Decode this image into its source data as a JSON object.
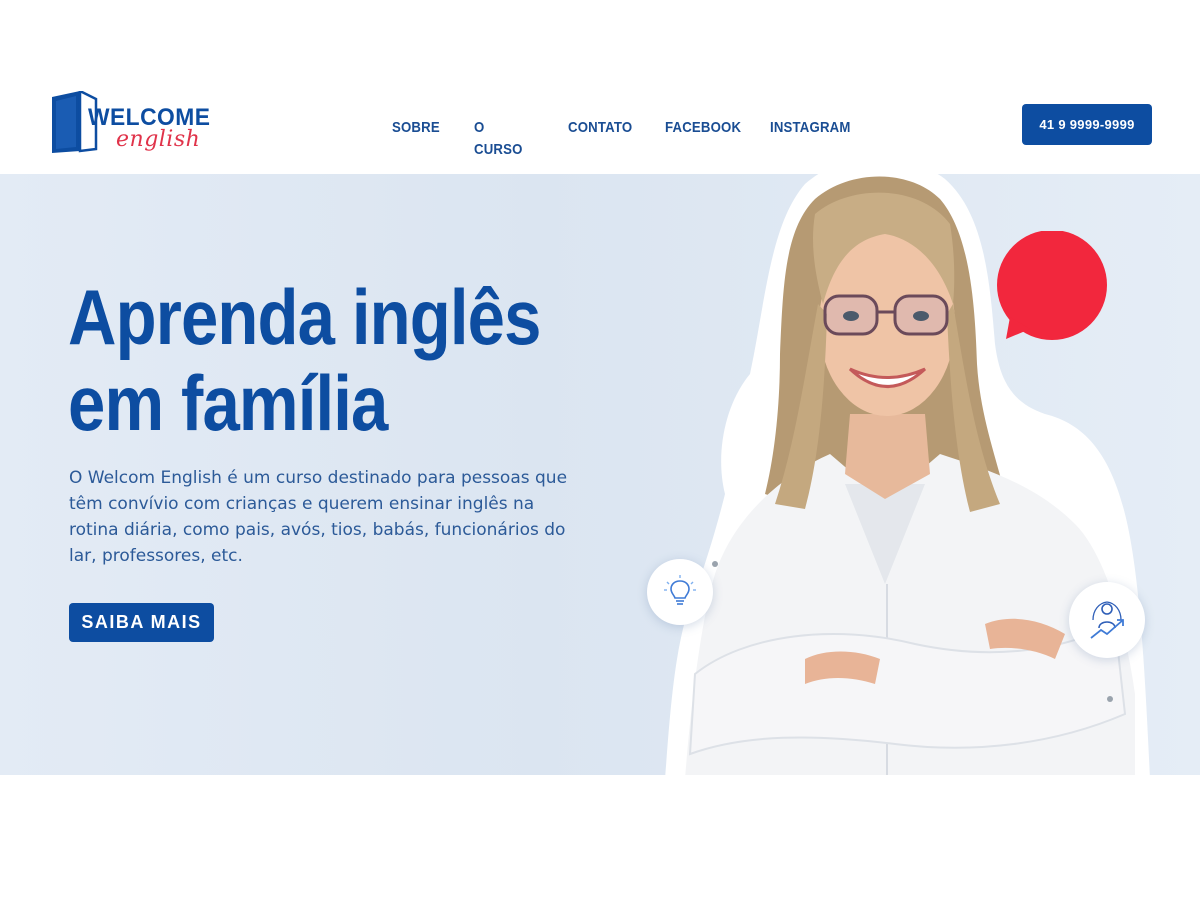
{
  "brand": {
    "logo_word1": "WELCOME",
    "logo_word2": "english",
    "primary_color": "#0d4da1",
    "accent_color": "#e0334a"
  },
  "nav": {
    "items": [
      "SOBRE",
      "O CURSO",
      "CONTATO",
      "FACEBOOK",
      "INSTAGRAM"
    ]
  },
  "header": {
    "phone_label": "41 9 9999-9999"
  },
  "hero": {
    "headline_line1": "Aprenda inglês",
    "headline_line2": "em família",
    "description": "O Welcom English é um curso destinado para pessoas que têm convívio com crianças e querem ensinar inglês na rotina diária, como pais, avós, tios, babás, funcionários do lar, professores, etc.",
    "cta_label": "SAIBA MAIS",
    "decorations": {
      "bubble_color": "#f2273d",
      "icon_left": "lightbulb-icon",
      "icon_right": "growth-person-icon"
    }
  }
}
